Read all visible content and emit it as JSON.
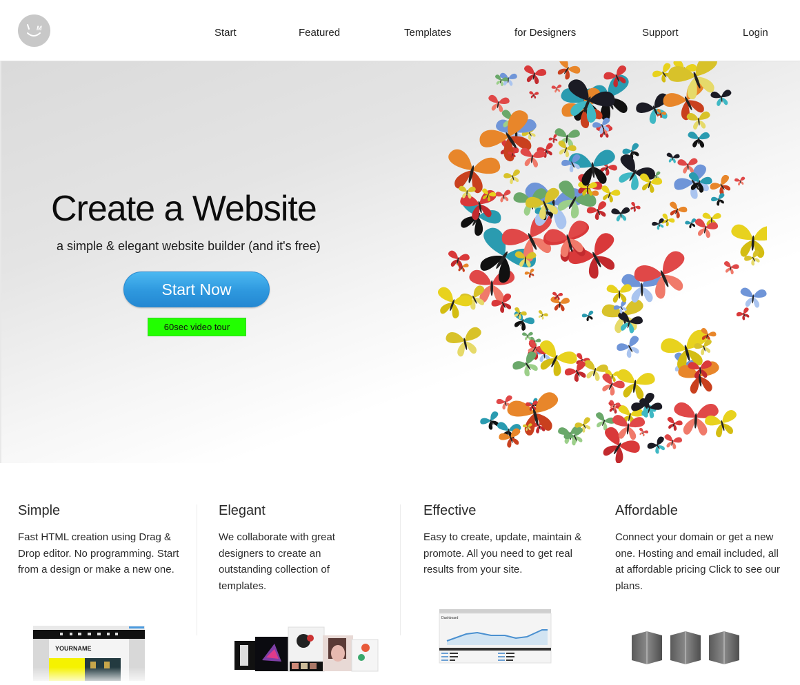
{
  "header": {
    "logo_alt": "smiley logo",
    "nav": [
      {
        "label": "Start"
      },
      {
        "label": "Featured"
      },
      {
        "label": "Templates"
      },
      {
        "label": "for Designers"
      },
      {
        "label": "Support"
      },
      {
        "label": "Login"
      }
    ]
  },
  "hero": {
    "title": "Create a Website",
    "subtitle": "a simple & elegant website builder (and it's free)",
    "cta_label": "Start Now",
    "video_tour_label": "60sec video tour",
    "image": "butterflies-illustration",
    "colors": {
      "cta": "#2e98de",
      "video_tour": "#22ff00"
    }
  },
  "features": [
    {
      "title": "Simple",
      "text": "Fast HTML creation using Drag & Drop editor. No programming. Start from a design or make a new one.",
      "image": "editor-screenshot",
      "thumb_text": "YOURNAME"
    },
    {
      "title": "Elegant",
      "text": "We collaborate with great designers to create an outstanding collection of templates.",
      "image": "template-collection"
    },
    {
      "title": "Effective",
      "text": "Easy to create, update, maintain & promote. All you need to get real results from your site.",
      "image": "analytics-dashboard"
    },
    {
      "title": "Affordable",
      "text": "Connect your domain or get a new one. Hosting and email included, all at affordable pricing Click to see our plans.",
      "image": "servers"
    }
  ]
}
